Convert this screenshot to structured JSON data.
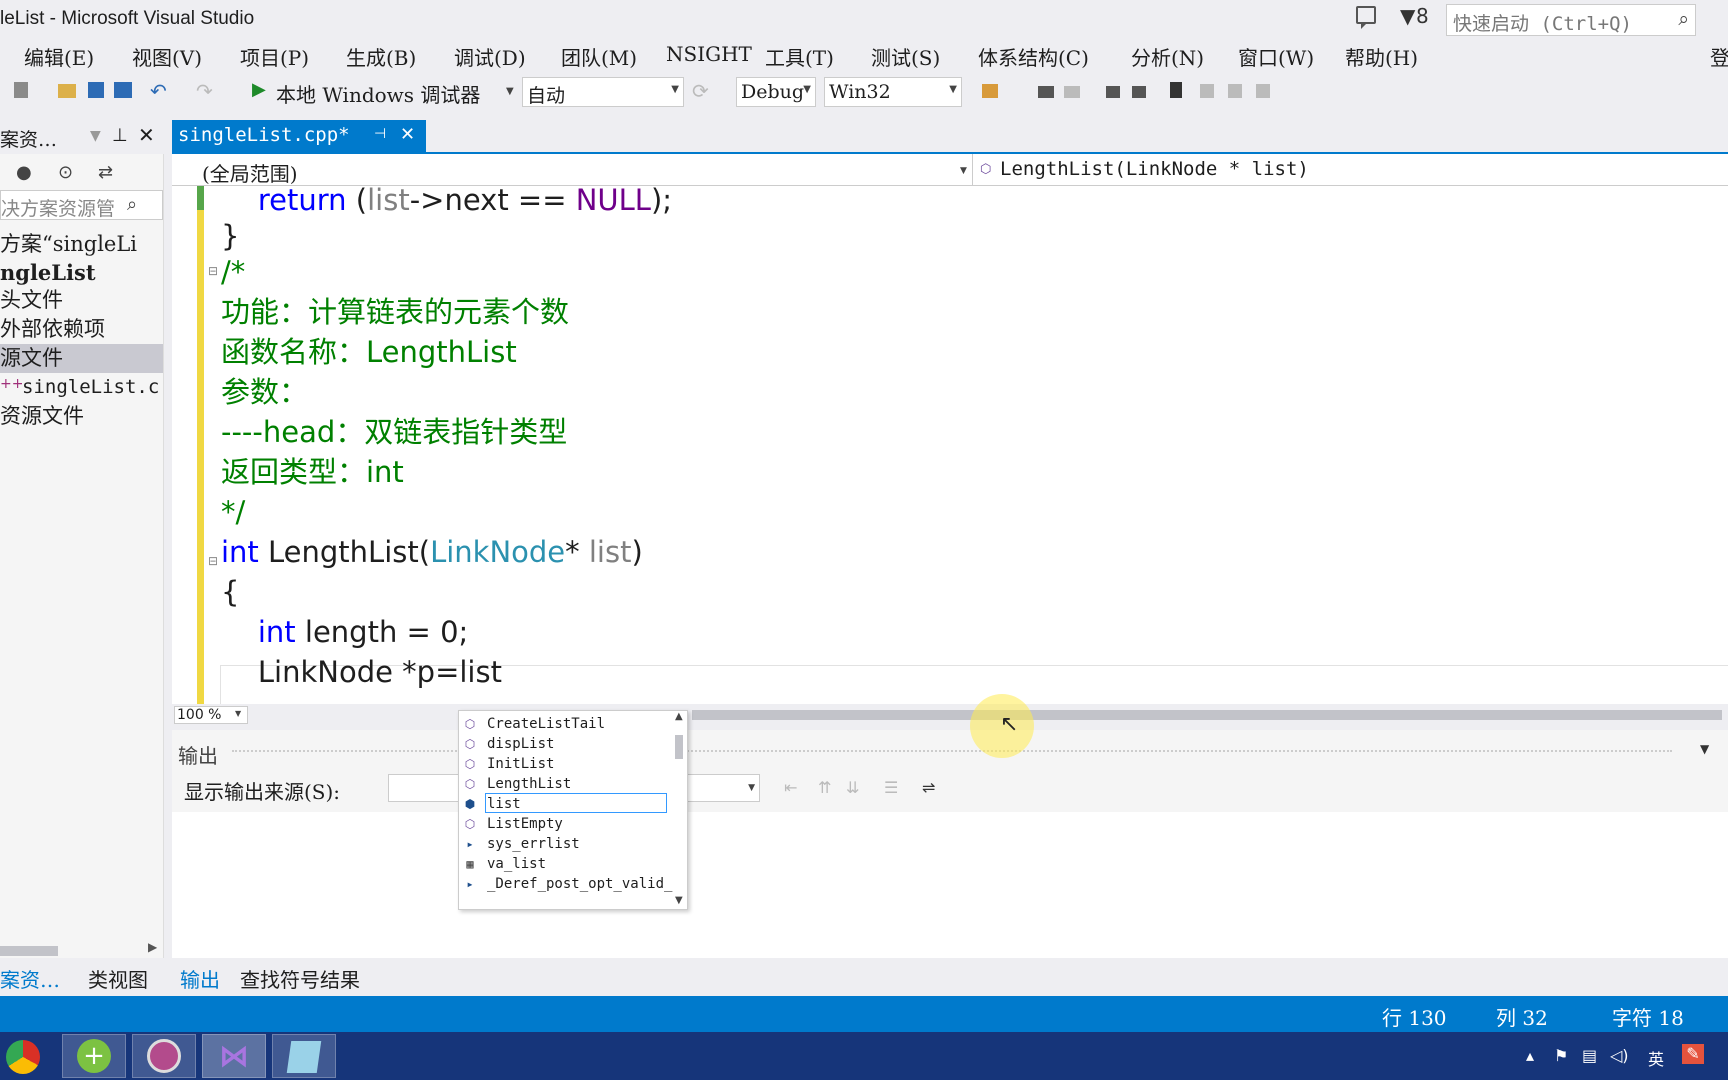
{
  "window": {
    "title": "leList - Microsoft Visual Studio",
    "notification_count": "8",
    "quick_launch_placeholder": "快速启动 (Ctrl+Q)"
  },
  "menu": [
    "编辑(E)",
    "视图(V)",
    "项目(P)",
    "生成(B)",
    "调试(D)",
    "团队(M)",
    "NSIGHT",
    "工具(T)",
    "测试(S)",
    "体系结构(C)",
    "分析(N)",
    "窗口(W)",
    "帮助(H)"
  ],
  "menu_extra": "登",
  "toolbar": {
    "debugger_label": "本地 Windows 调试器",
    "solution_mode": "自动",
    "configuration": "Debug",
    "platform": "Win32"
  },
  "solution_explorer": {
    "title": "案资…",
    "search_placeholder": "决方案资源管",
    "items": [
      "方案“singleLi",
      "ngleList",
      "头文件",
      "外部依赖项",
      "源文件",
      "singleList.c",
      "资源文件"
    ],
    "selected_index": 4
  },
  "editor": {
    "tab_label": "singleList.cpp*",
    "scope": "(全局范围)",
    "function": "LengthList(LinkNode * list)",
    "zoom": "100 %",
    "lines": [
      {
        "segments": [
          {
            "t": "    ",
            "c": ""
          },
          {
            "t": "return",
            "c": "kw"
          },
          {
            "t": " (",
            "c": ""
          },
          {
            "t": "list",
            "c": "pm"
          },
          {
            "t": "->next == ",
            "c": ""
          },
          {
            "t": "NULL",
            "c": "mc"
          },
          {
            "t": ");",
            "c": ""
          }
        ]
      },
      {
        "segments": [
          {
            "t": "}",
            "c": ""
          }
        ]
      },
      {
        "segments": [
          {
            "t": "/*",
            "c": "cm"
          }
        ]
      },
      {
        "segments": [
          {
            "t": "功能：计算链表的元素个数",
            "c": "cm"
          }
        ]
      },
      {
        "segments": [
          {
            "t": "函数名称：LengthList",
            "c": "cm"
          }
        ]
      },
      {
        "segments": [
          {
            "t": "参数：",
            "c": "cm"
          }
        ]
      },
      {
        "segments": [
          {
            "t": "----head：双链表指针类型",
            "c": "cm"
          }
        ]
      },
      {
        "segments": [
          {
            "t": "返回类型：int",
            "c": "cm"
          }
        ]
      },
      {
        "segments": [
          {
            "t": "*/",
            "c": "cm"
          }
        ]
      },
      {
        "segments": [
          {
            "t": "int",
            "c": "kw"
          },
          {
            "t": " LengthList(",
            "c": ""
          },
          {
            "t": "LinkNode",
            "c": "ty"
          },
          {
            "t": "* ",
            "c": ""
          },
          {
            "t": "list",
            "c": "pm"
          },
          {
            "t": ")",
            "c": ""
          }
        ]
      },
      {
        "segments": [
          {
            "t": "{",
            "c": ""
          }
        ]
      },
      {
        "segments": [
          {
            "t": "    ",
            "c": ""
          },
          {
            "t": "int",
            "c": "kw"
          },
          {
            "t": " length = 0;",
            "c": ""
          }
        ]
      },
      {
        "segments": [
          {
            "t": "    LinkNode *p=list",
            "c": ""
          }
        ]
      }
    ]
  },
  "autocomplete": {
    "items": [
      {
        "label": "CreateListTail",
        "icon": "method-icon"
      },
      {
        "label": "dispList",
        "icon": "method-icon"
      },
      {
        "label": "InitList",
        "icon": "method-icon"
      },
      {
        "label": "LengthList",
        "icon": "method-icon"
      },
      {
        "label": "list",
        "icon": "variable-icon"
      },
      {
        "label": "ListEmpty",
        "icon": "method-icon"
      },
      {
        "label": "sys_errlist",
        "icon": "field-icon"
      },
      {
        "label": "va_list",
        "icon": "typedef-icon"
      },
      {
        "label": "_Deref_post_opt_valid_",
        "icon": "field-icon"
      }
    ],
    "selected_index": 4
  },
  "output": {
    "title": "输出",
    "source_label": "显示输出来源(S):"
  },
  "bottom_tabs": {
    "left": [
      "案资…",
      "类视图"
    ],
    "right": [
      "输出",
      "查找符号结果"
    ]
  },
  "status": {
    "line": "行 130",
    "col": "列 32",
    "char": "字符 18"
  },
  "taskbar": {
    "tray_lang": "英"
  },
  "colors": {
    "accent": "#007acc",
    "comment": "#008000",
    "keyword": "#0000ff",
    "type": "#2b91af",
    "taskbar": "#16357a"
  }
}
